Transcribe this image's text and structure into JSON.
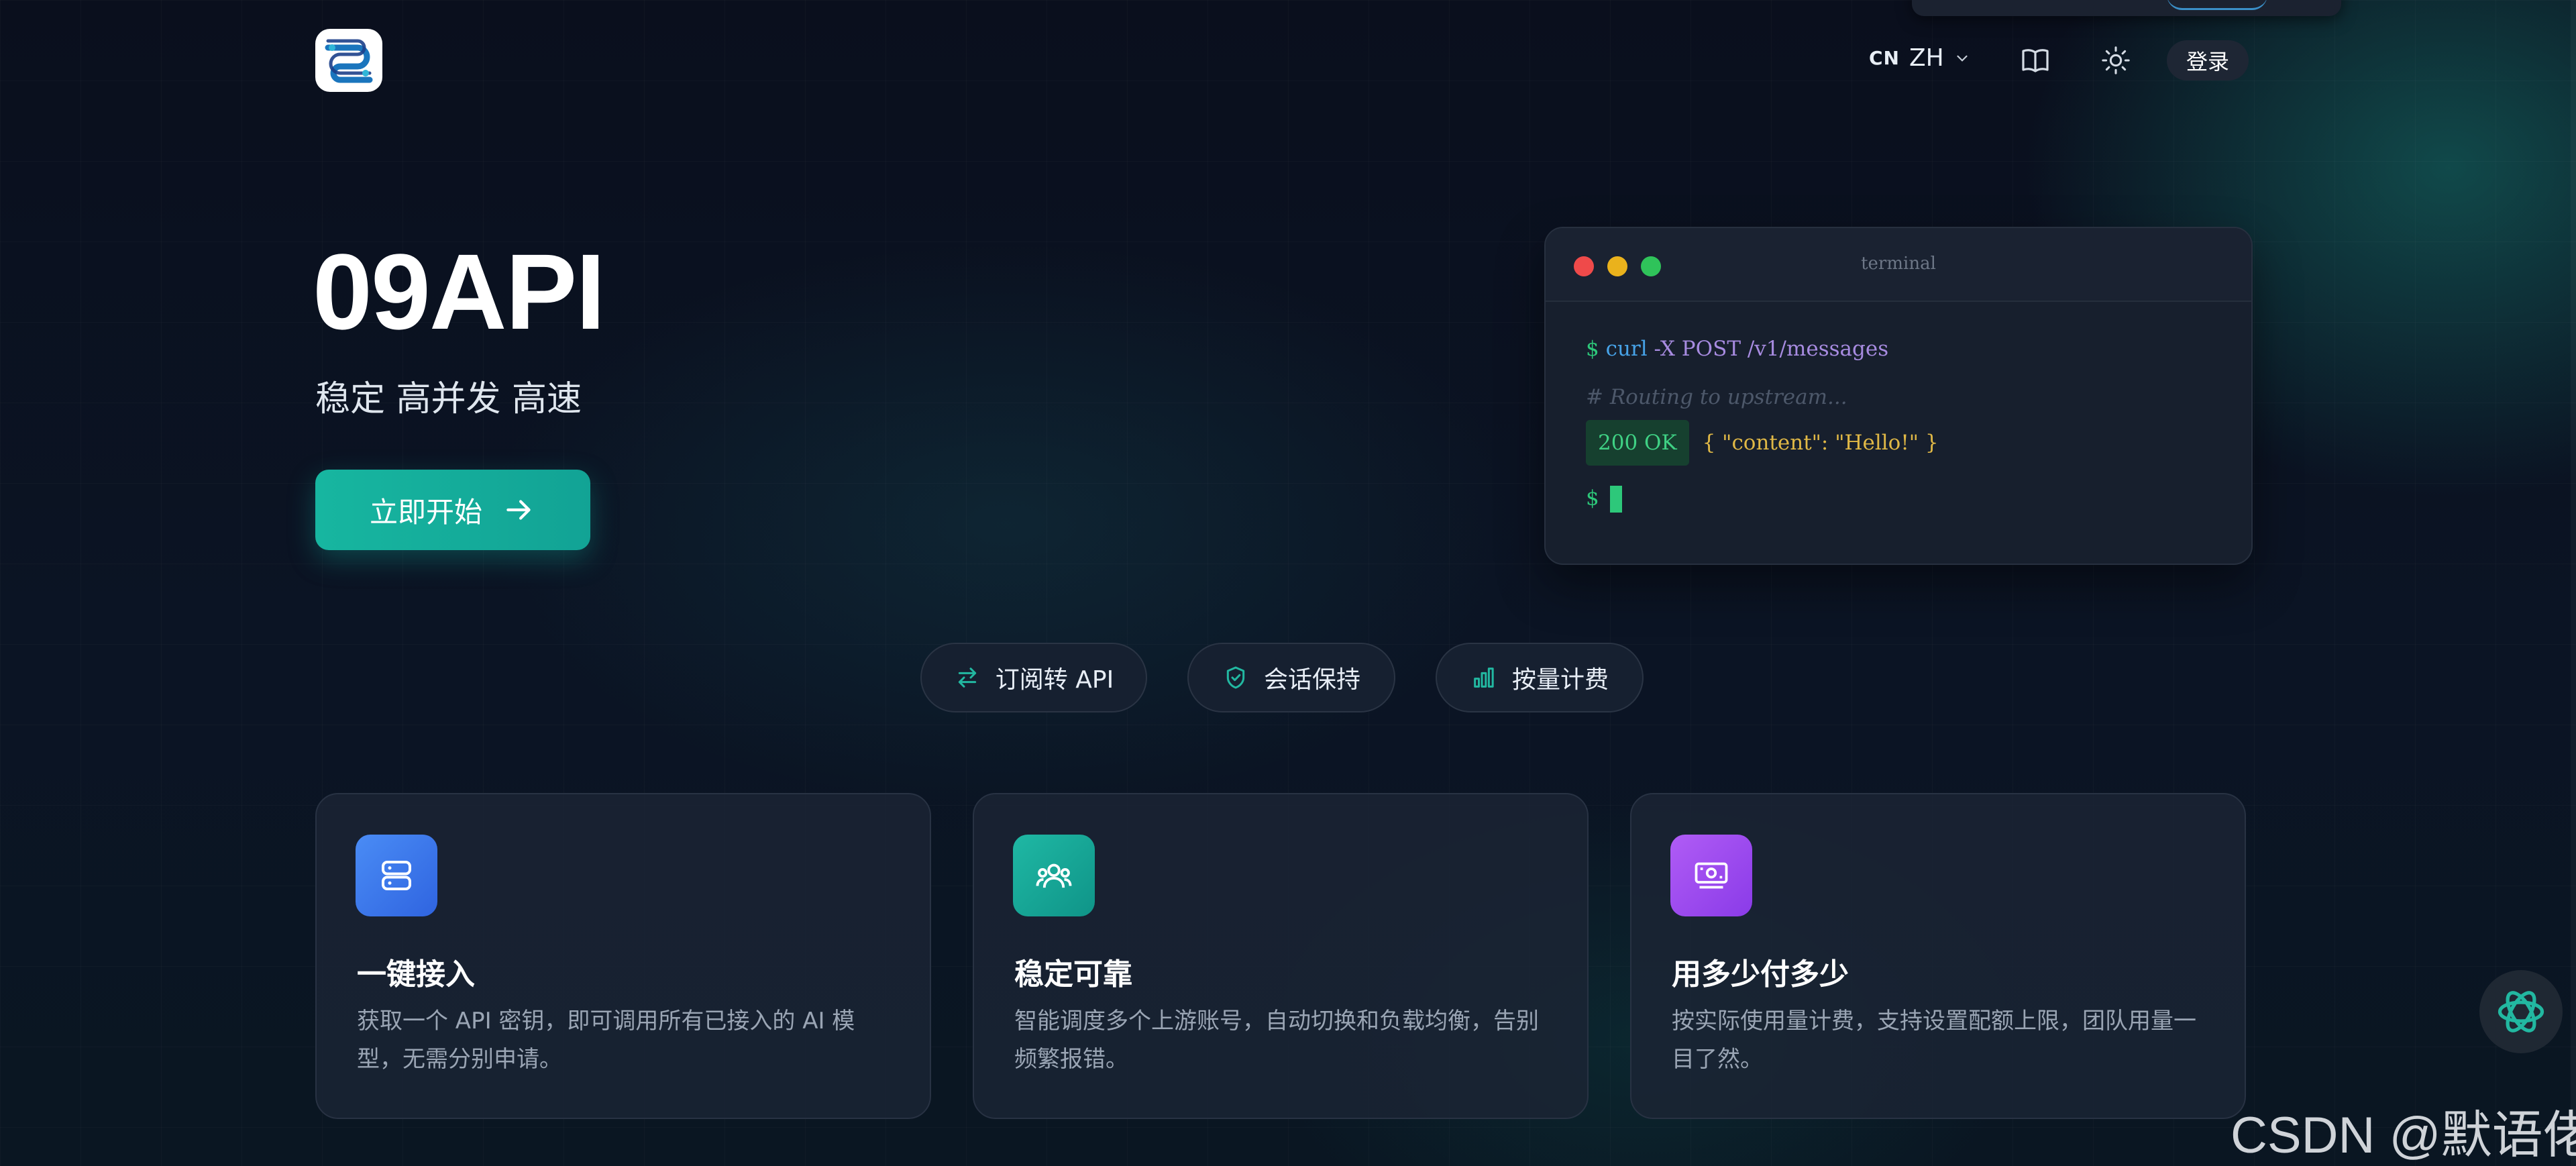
{
  "header": {
    "language": {
      "flag": "CN",
      "code": "ZH"
    },
    "login_label": "登录"
  },
  "hero": {
    "title": "09API",
    "subtitle": "稳定 高并发 高速",
    "cta_label": "立即开始"
  },
  "terminal": {
    "title": "terminal",
    "prompt": "$",
    "command": "curl",
    "command_args": "-X POST /v1/messages",
    "comment": "# Routing to upstream...",
    "status": "200 OK",
    "response": "{ \"content\": \"Hello!\" }"
  },
  "feature_pills": [
    {
      "label": "订阅转 API",
      "icon": "arrows-exchange-icon"
    },
    {
      "label": "会话保持",
      "icon": "shield-check-icon"
    },
    {
      "label": "按量计费",
      "icon": "bar-chart-icon"
    }
  ],
  "cards": [
    {
      "title": "一键接入",
      "description": "获取一个 API 密钥，即可调用所有已接入的 AI 模型，无需分别申请。",
      "icon": "server-icon",
      "color": "#3b7cf0"
    },
    {
      "title": "稳定可靠",
      "description": "智能调度多个上游账号，自动切换和负载均衡，告别频繁报错。",
      "icon": "users-icon",
      "color": "#15a595"
    },
    {
      "title": "用多少付多少",
      "description": "按实际使用量计费，支持设置配额上限，团队用量一目了然。",
      "icon": "money-icon",
      "color": "#9b4ff0"
    }
  ],
  "watermark": "CSDN @默语佬",
  "colors": {
    "accent": "#17b6a0",
    "background": "#0a1120",
    "terminal_green": "#2dc87a"
  }
}
